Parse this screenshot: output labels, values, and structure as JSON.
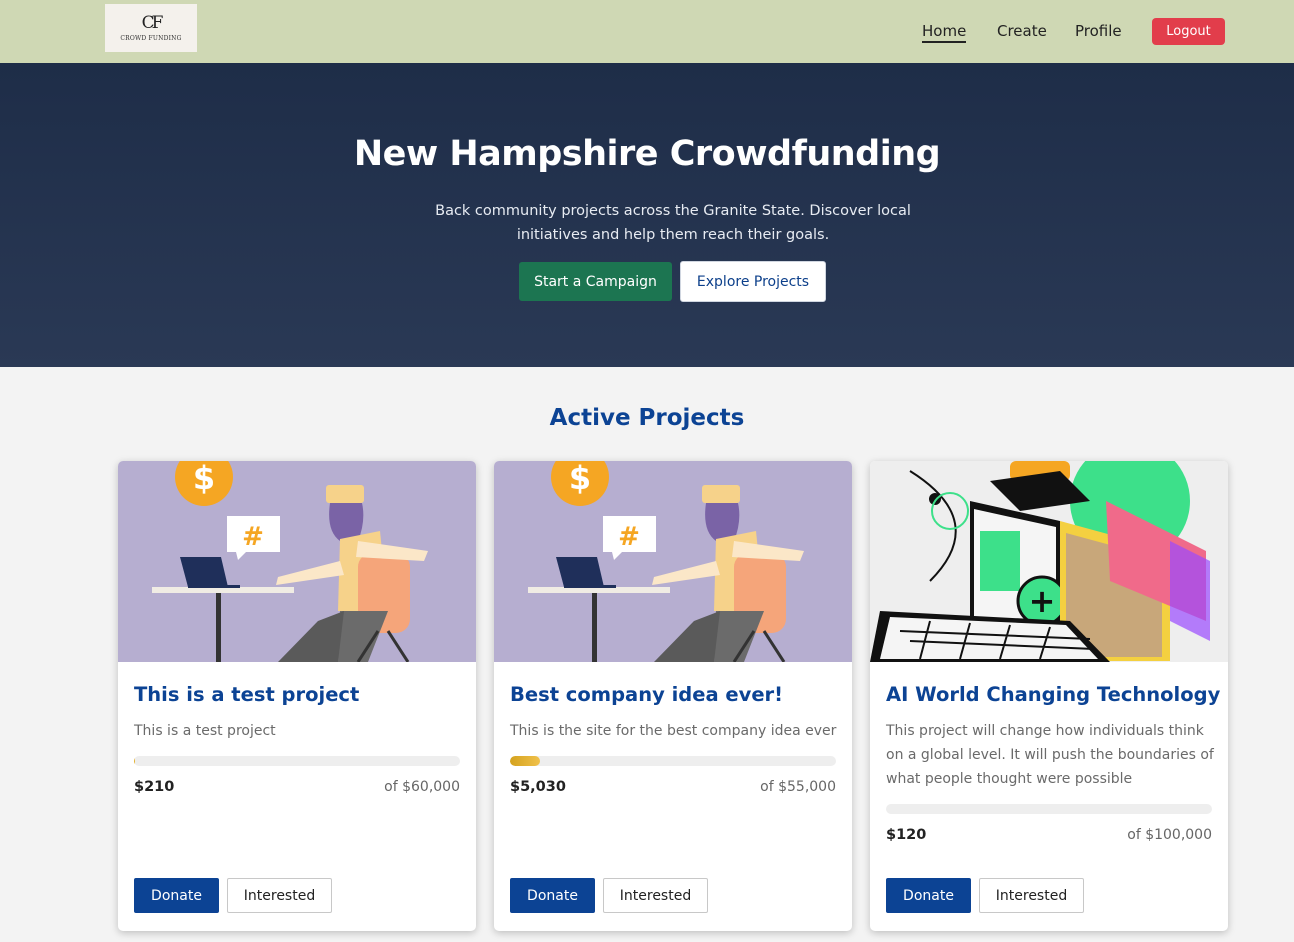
{
  "nav": {
    "logo_mark": "CF",
    "logo_text": "CROWD FUNDING",
    "links": [
      {
        "label": "Home",
        "active": true
      },
      {
        "label": "Create",
        "active": false
      },
      {
        "label": "Profile",
        "active": false
      }
    ],
    "logout_label": "Logout"
  },
  "hero": {
    "title": "New Hampshire Crowdfunding",
    "subtitle": "Back community projects across the Granite State. Discover local initiatives and help them reach their goals.",
    "primary_button": "Start a Campaign",
    "secondary_button": "Explore Projects"
  },
  "projects_section": {
    "title": "Active Projects",
    "cards": [
      {
        "title": "This is a test project",
        "description": "This is a test project",
        "raised": "$210",
        "goal": "of $60,000",
        "progress_fraction": 0.0035,
        "image": "person-at-laptop-illustration",
        "donate_label": "Donate",
        "interested_label": "Interested"
      },
      {
        "title": "Best company idea ever!",
        "description": "This is the site for the best company idea ever",
        "raised": "$5,030",
        "goal": "of $55,000",
        "progress_fraction": 0.0915,
        "image": "person-at-laptop-illustration",
        "donate_label": "Donate",
        "interested_label": "Interested"
      },
      {
        "title": "AI World Changing Technology",
        "description": "This project will change how individuals think on a global level. It will push the boundaries of what people thought were possible",
        "raised": "$120",
        "goal": "of $100,000",
        "progress_fraction": 0.0012,
        "image": "isometric-laptop-illustration",
        "donate_label": "Donate",
        "interested_label": "Interested"
      }
    ]
  },
  "colors": {
    "nav_bg": "#cfd8b4",
    "hero_bg": "#1e2d48",
    "brand_blue": "#0c4394",
    "start_green": "#1c7551",
    "logout_red": "#e23d4b",
    "progress_gold": "#d4a21e"
  }
}
